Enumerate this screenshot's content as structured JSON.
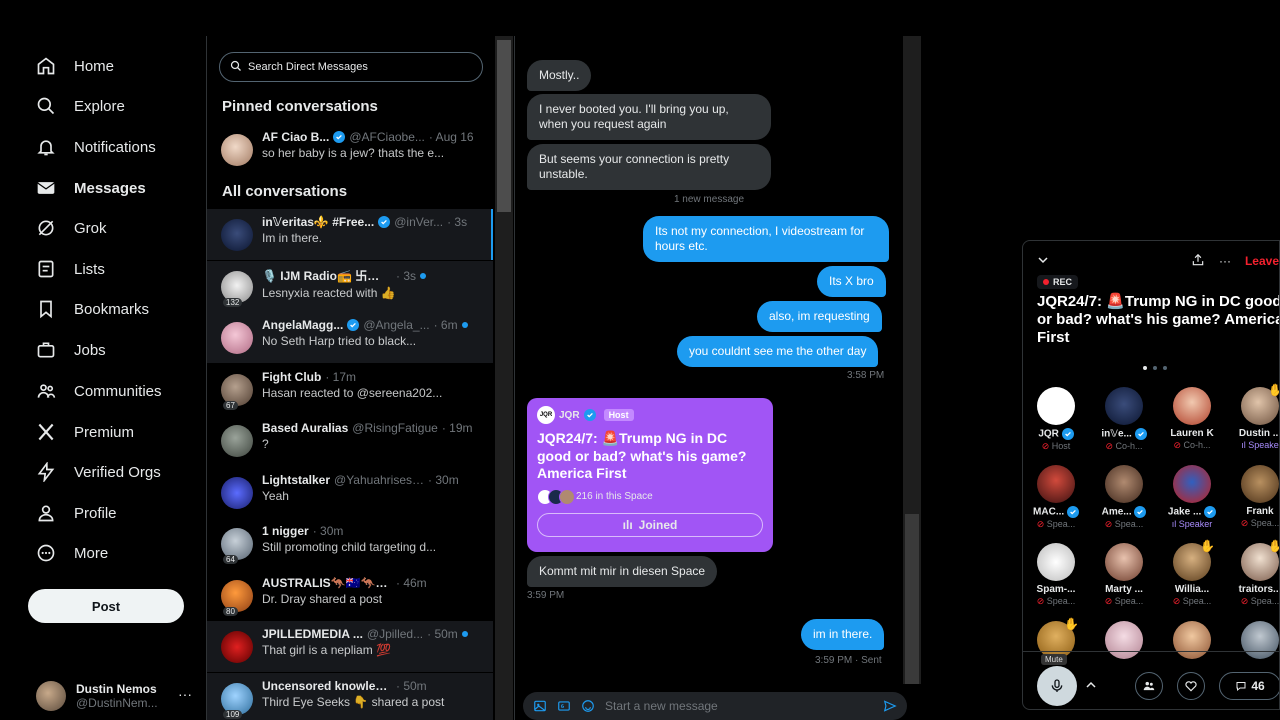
{
  "nav": {
    "items": [
      {
        "label": "Home",
        "icon": "home-icon"
      },
      {
        "label": "Explore",
        "icon": "search-icon"
      },
      {
        "label": "Notifications",
        "icon": "bell-icon"
      },
      {
        "label": "Messages",
        "icon": "mail-icon"
      },
      {
        "label": "Grok",
        "icon": "grok-icon"
      },
      {
        "label": "Lists",
        "icon": "list-icon"
      },
      {
        "label": "Bookmarks",
        "icon": "bookmark-icon"
      },
      {
        "label": "Jobs",
        "icon": "briefcase-icon"
      },
      {
        "label": "Communities",
        "icon": "people-icon"
      },
      {
        "label": "Premium",
        "icon": "x-logo-icon"
      },
      {
        "label": "Verified Orgs",
        "icon": "lightning-icon"
      },
      {
        "label": "Profile",
        "icon": "person-icon"
      },
      {
        "label": "More",
        "icon": "more-circle-icon"
      }
    ],
    "post_label": "Post",
    "account": {
      "name": "Dustin Nemos",
      "handle": "@DustinNem..."
    }
  },
  "list": {
    "search_placeholder": "Search Direct Messages",
    "pinned_title": "Pinned conversations",
    "all_title": "All conversations",
    "pinned": [
      {
        "name": "AF Ciao B...",
        "handle": "@AFCiaobe...",
        "time": "· Aug 16",
        "preview": "so her baby is a jew? thats the e...",
        "verified": true,
        "unread": false
      }
    ],
    "conversations": [
      {
        "name": "in𝕍eritas⚜️ #Free...",
        "handle": "@inVer...",
        "time": "· 3s",
        "preview": "Im in there.",
        "verified": true,
        "unread": false,
        "badge": ""
      },
      {
        "name": "🎙️ IJM Radio📻 卐☯️☦️✝️...",
        "handle": "",
        "time": "· 3s",
        "preview": "Lesnyxia reacted with 👍",
        "verified": false,
        "unread": true,
        "badge": "132"
      },
      {
        "name": "AngelaMagg...",
        "handle": "@Angela_...",
        "time": "· 6m",
        "preview": "No Seth Harp tried to black...",
        "verified": true,
        "unread": true,
        "badge": ""
      },
      {
        "name": "Fight Club",
        "handle": "",
        "time": "· 17m",
        "preview": "Hasan reacted to @sereena202...",
        "verified": false,
        "unread": false,
        "badge": "67"
      },
      {
        "name": "Based Auralias",
        "handle": "@RisingFatigue",
        "time": "· 19m",
        "preview": "?",
        "verified": false,
        "unread": false,
        "badge": ""
      },
      {
        "name": "Lightstalker",
        "handle": "@Yahuahrises82",
        "time": "· 30m",
        "preview": "Yeah",
        "verified": false,
        "unread": false,
        "badge": ""
      },
      {
        "name": "1 nigger",
        "handle": "",
        "time": "· 30m",
        "preview": "Still promoting child targeting d...",
        "verified": false,
        "unread": false,
        "badge": "64"
      },
      {
        "name": "AUSTRALIS🦘🇦🇺🦘🌈...",
        "handle": "",
        "time": "· 46m",
        "preview": "Dr. Dray shared a post",
        "verified": false,
        "unread": false,
        "badge": "80"
      },
      {
        "name": "JPILLEDMEDIA ...",
        "handle": "@Jpilled...",
        "time": "· 50m",
        "preview": "That girl is a nepliam 💯",
        "verified": false,
        "unread": true,
        "badge": ""
      },
      {
        "name": "Uncensored knowledge Clu...",
        "handle": "",
        "time": "· 50m",
        "preview": "Third Eye Seeks 👇 shared a post",
        "verified": false,
        "unread": false,
        "badge": "109"
      }
    ]
  },
  "chat": {
    "messages": [
      {
        "dir": "in",
        "text": "Mostly.."
      },
      {
        "dir": "in",
        "text": "I never booted you. I'll bring you up, when you request again"
      },
      {
        "dir": "in",
        "text": "But seems your connection is pretty unstable."
      },
      {
        "dir": "out",
        "text": "Its not my connection, I videostream for hours etc."
      },
      {
        "dir": "out",
        "text": "Its X bro"
      },
      {
        "dir": "out",
        "text": "also, im requesting"
      },
      {
        "dir": "out",
        "text": "you couldnt see me the other day"
      },
      {
        "dir": "in",
        "text": "Kommt mit mir in diesen Space"
      },
      {
        "dir": "out",
        "text": "im in there."
      }
    ],
    "new_message_label": "1 new message",
    "time_1": "3:58 PM",
    "time_2": "3:59 PM",
    "time_3": "3:59 PM · Sent",
    "space_card": {
      "host_name": "JQR",
      "host_tag": "Host",
      "logo_text": "JQR",
      "title": "JQR24/7: 🚨Trump NG in DC good or bad? what's his game? America First",
      "listeners": "216 in this Space",
      "join_label": "Joined"
    },
    "composer_placeholder": "Start a new message"
  },
  "space": {
    "rec_label": "REC",
    "leave_label": "Leave",
    "title": "JQR24/7: 🚨Trump NG in DC good or bad? what's his game? America First",
    "participants": [
      {
        "name": "JQR",
        "role": "Host",
        "verified": true
      },
      {
        "name": "in𝕍e...",
        "role": "Co-h...",
        "verified": true
      },
      {
        "name": "Lauren K",
        "role": "Co-h...",
        "verified": false
      },
      {
        "name": "Dustin ...",
        "role": "Speake",
        "verified": false
      },
      {
        "name": "MAC...",
        "role": "Spea...",
        "verified": true
      },
      {
        "name": "Ame...",
        "role": "Spea...",
        "verified": true
      },
      {
        "name": "Jake ...",
        "role": "Speaker",
        "verified": true
      },
      {
        "name": "Frank",
        "role": "Spea...",
        "verified": false
      },
      {
        "name": "Spam-...",
        "role": "Spea...",
        "verified": false
      },
      {
        "name": "Marty ...",
        "role": "Spea...",
        "verified": false
      },
      {
        "name": "Willia...",
        "role": "Spea...",
        "verified": false
      },
      {
        "name": "traitors...",
        "role": "Spea...",
        "verified": false
      },
      {
        "name": "",
        "role": "",
        "verified": false
      },
      {
        "name": "",
        "role": "",
        "verified": false
      },
      {
        "name": "",
        "role": "",
        "verified": false
      },
      {
        "name": "",
        "role": "",
        "verified": false
      }
    ],
    "mute_tip": "Mute",
    "reply_count": "46"
  },
  "colors": {
    "accent": "#1d9bf0",
    "space_purple": "#a155f5",
    "leave_red": "#f4212e"
  }
}
